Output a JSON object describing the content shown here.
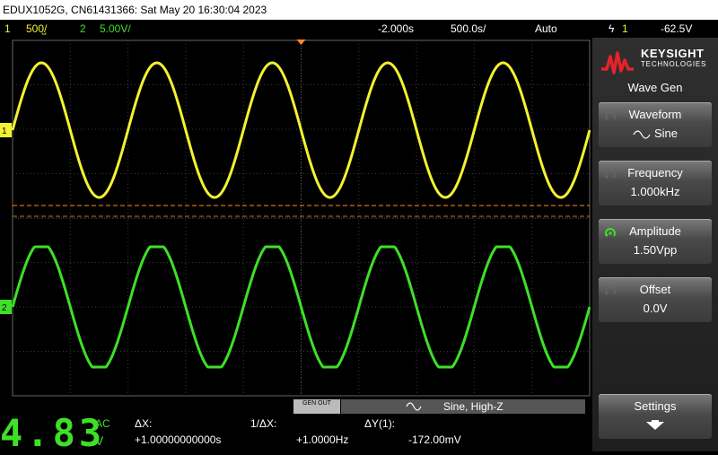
{
  "title": "EDUX1052G, CN61431366: Sat May 20 16:30:04 2023",
  "status": {
    "ch1_num": "1",
    "ch1_scale": "500̺/",
    "ch2_num": "2",
    "ch2_scale": "5.00V/",
    "time_delay": "-2.000s",
    "time_scale": "500.0s/",
    "trigger_mode": "Auto",
    "trigger_icon": "ϟ",
    "trigger_source": "1",
    "trigger_level": "-62.5V"
  },
  "colors": {
    "ch1": "#f2f230",
    "ch2": "#3ee027",
    "trigger": "#ff8c1a",
    "grid": "#3a3a3a"
  },
  "panel": {
    "brand": "KEYSIGHT",
    "brand_sub": "TECHNOLOGIES",
    "menu_title": "Wave Gen",
    "softkeys": [
      {
        "label": "Waveform",
        "value": "Sine",
        "active": false
      },
      {
        "label": "Frequency",
        "value": "1.000kHz",
        "active": false
      },
      {
        "label": "Amplitude",
        "value": "1.50Vpp",
        "active": true
      },
      {
        "label": "Offset",
        "value": "0.0V",
        "active": false
      }
    ],
    "settings_label": "Settings"
  },
  "wavegen_bar": {
    "gen_out": "GEN OUT",
    "info": "Sine, High-Z"
  },
  "measurements": {
    "dvm_value": "4.83",
    "dvm_mode": "AC",
    "dvm_unit": "V",
    "dx_label": "ΔX:",
    "dx_value": "+1.00000000000s",
    "inv_dx_label": "1/ΔX:",
    "inv_dx_value": "+1.0000Hz",
    "dy_label": "ΔY(1):",
    "dy_value": "-172.00mV"
  },
  "channel_markers": {
    "ch1": "1",
    "ch2": "2"
  },
  "waveforms": {
    "cycles_visible": 5
  }
}
